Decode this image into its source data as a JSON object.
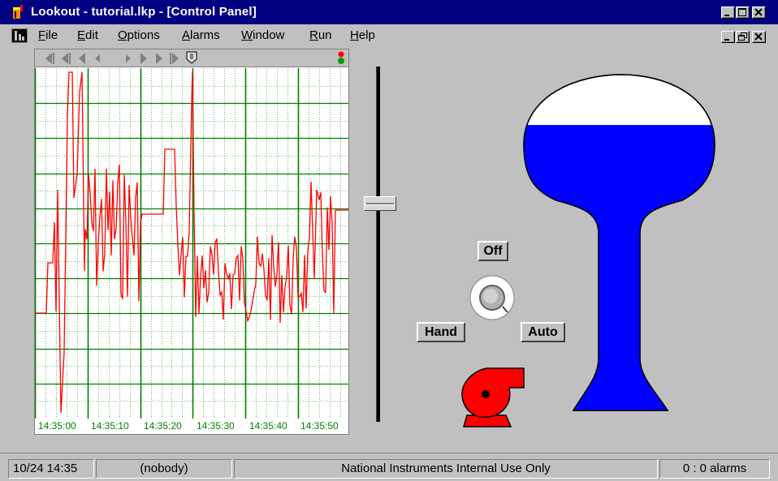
{
  "window": {
    "title": "Lookout - tutorial.lkp - [Control Panel]"
  },
  "menu": {
    "items": [
      "File",
      "Edit",
      "Options",
      "Alarms",
      "Window",
      "Run",
      "Help"
    ]
  },
  "trend": {
    "time_labels": [
      "14:35:00",
      "14:35:10",
      "14:35:20",
      "14:35:30",
      "14:35:40",
      "14:35:50"
    ],
    "line_color": "#ff0000",
    "grid_color": "#008000"
  },
  "controls": {
    "off_label": "Off",
    "hand_label": "Hand",
    "auto_label": "Auto",
    "slider_level": 0.62
  },
  "tank": {
    "fill_level": 0.85,
    "water_color": "#0000ff"
  },
  "pump": {
    "color": "#ff0000"
  },
  "status": {
    "datetime": "10/24 14:35",
    "user": "(nobody)",
    "message": "National Instruments Internal Use Only",
    "alarms": "0 : 0 alarms"
  }
}
